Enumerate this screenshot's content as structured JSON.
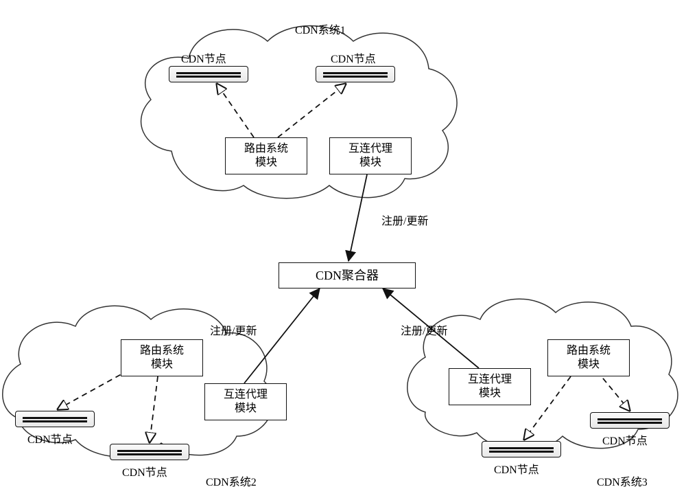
{
  "title": {
    "system1": "CDN系统1",
    "system2": "CDN系统2",
    "system3": "CDN系统3"
  },
  "node_label": "CDN节点",
  "module": {
    "routing": "路由系统\n模块",
    "interconnect": "互连代理\n模块"
  },
  "aggregator": "CDN聚合器",
  "edge_label": "注册/更新"
}
